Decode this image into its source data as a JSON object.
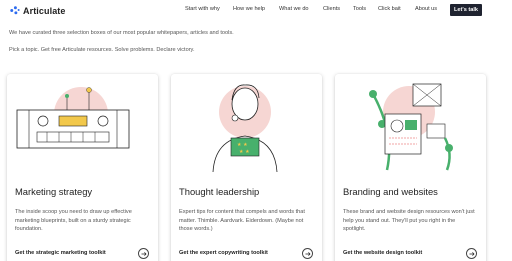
{
  "header": {
    "logo_text": "Articulate",
    "nav": [
      "Start with why",
      "How we help",
      "What we do",
      "Clients",
      "Tools",
      "Click bait",
      "About us"
    ],
    "cta_label": "Let's talk"
  },
  "intro": {
    "line1": "We have curated three selection boxes of our most popular whitepapers, articles and tools.",
    "line2": "Pick a topic. Get free Articulate resources. Solve problems. Declare victory."
  },
  "cards": [
    {
      "title": "Marketing strategy",
      "description": "The inside scoop you need to draw up effective marketing blueprints, built on a sturdy strategic foundation.",
      "link": "Get the strategic marketing toolkit",
      "illustration": "control-panel"
    },
    {
      "title": "Thought leadership",
      "description": "Expert tips for content that compels and words that matter. Thimble. Aardvark. Eiderdown. (Maybe not those words.)",
      "link": "Get the expert copywriting toolkit",
      "illustration": "thinker-with-stars"
    },
    {
      "title": "Branding and websites",
      "description": "These brand and website design resources won't just help you stand out. They'll put you right in the spotlight.",
      "link": "Get the website design toolkit",
      "illustration": "design-layout-tools"
    }
  ],
  "colors": {
    "accent_pink": "#f6d6d3",
    "accent_green": "#48b06c",
    "accent_yellow": "#f2c84b",
    "accent_blue": "#2e6cf0",
    "cta_bg": "#1f2330"
  },
  "icons": [
    "articulate-logo-icon",
    "arrow-right-icon"
  ]
}
